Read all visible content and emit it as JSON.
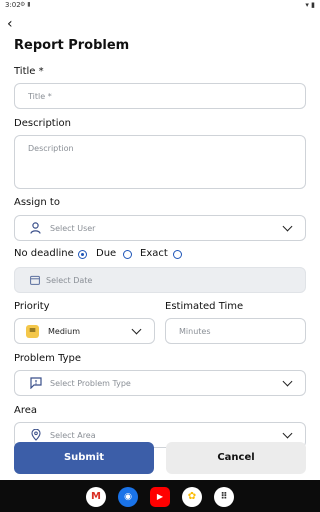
{
  "status": {
    "time": "3:02",
    "left_icons": "⚙ ▮",
    "right_icons": "▾ ▮"
  },
  "header": {
    "back_glyph": "‹",
    "title": "Report Problem"
  },
  "form": {
    "title": {
      "label": "Title *",
      "placeholder": "Title *"
    },
    "description": {
      "label": "Description",
      "placeholder": "Description"
    },
    "assign": {
      "label": "Assign to",
      "placeholder": "Select User"
    },
    "deadline": {
      "options": [
        "No deadline",
        "Due",
        "Exact"
      ],
      "selected": "Due",
      "date_placeholder": "Select Date"
    },
    "priority": {
      "label": "Priority",
      "value": "Medium",
      "badge": "="
    },
    "estimated_time": {
      "label": "Estimated Time",
      "placeholder": "Minutes"
    },
    "problem_type": {
      "label": "Problem Type",
      "placeholder": "Select Problem Type"
    },
    "area": {
      "label": "Area",
      "placeholder": "Select Area"
    }
  },
  "actions": {
    "submit": "Submit",
    "cancel": "Cancel"
  },
  "navbar": {
    "apps": [
      {
        "name": "Gmail",
        "glyph": "M",
        "color": "#d93025"
      },
      {
        "name": "Chrome",
        "glyph": "◉",
        "color": "#1a73e8"
      },
      {
        "name": "YouTube",
        "glyph": "▶",
        "color": "#ff0000"
      },
      {
        "name": "Photos",
        "glyph": "✿",
        "color": "#fbbc04"
      },
      {
        "name": "Apps",
        "glyph": "⠿",
        "color": "#333333"
      }
    ]
  }
}
